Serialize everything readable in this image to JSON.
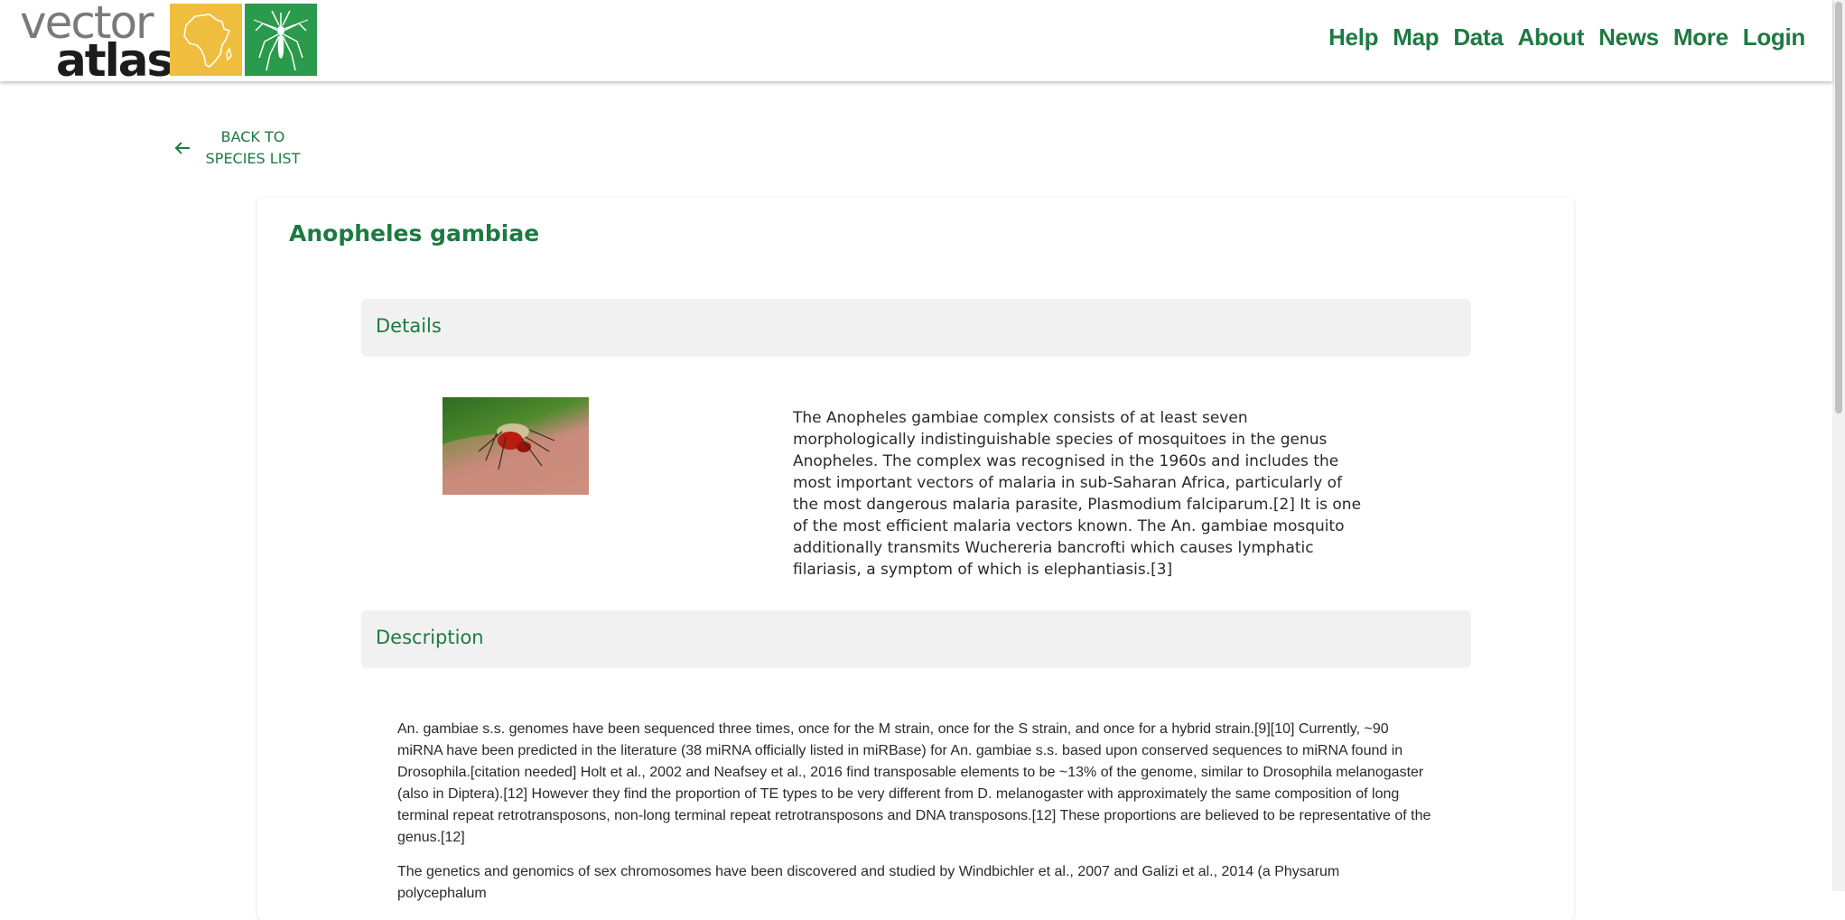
{
  "header": {
    "logo": {
      "line1": "vector",
      "line2": "atlas"
    },
    "nav": [
      "Help",
      "Map",
      "Data",
      "About",
      "News",
      "More",
      "Login"
    ]
  },
  "back_link": {
    "line1": "BACK TO",
    "line2": "SPECIES LIST"
  },
  "species": {
    "title": "Anopheles gambiae",
    "details_heading": "Details",
    "details_text": "The Anopheles gambiae complex consists of at least seven morphologically indistinguishable species of mosquitoes in the genus Anopheles. The complex was recognised in the 1960s and includes the most important vectors of malaria in sub-Saharan Africa, particularly of the most dangerous malaria parasite, Plasmodium falciparum.[2] It is one of the most efficient malaria vectors known. The An. gambiae mosquito additionally transmits Wuchereria bancrofti which causes lymphatic filariasis, a symptom of which is elephantiasis.[3]",
    "description_heading": "Description",
    "description_paragraphs": [
      "An. gambiae s.s. genomes have been sequenced three times, once for the M strain, once for the S strain, and once for a hybrid strain.[9][10] Currently, ~90 miRNA have been predicted in the literature (38 miRNA officially listed in miRBase) for An. gambiae s.s. based upon conserved sequences to miRNA found in Drosophila.[citation needed] Holt et al., 2002 and Neafsey et al., 2016 find transposable elements to be ~13% of the genome, similar to Drosophila melanogaster (also in Diptera).[12] However they find the proportion of TE types to be very different from D. melanogaster with approximately the same composition of long terminal repeat retrotransposons, non-long terminal repeat retrotransposons and DNA transposons.[12] These proportions are believed to be representative of the genus.[12]",
      "The genetics and genomics of sex chromosomes have been discovered and studied by Windbichler et al., 2007 and Galizi et al., 2014 (a Physarum polycephalum"
    ]
  },
  "colors": {
    "brand_green": "#1d7a41",
    "logo_yellow": "#f0be3e",
    "logo_green": "#2a9a4c"
  }
}
